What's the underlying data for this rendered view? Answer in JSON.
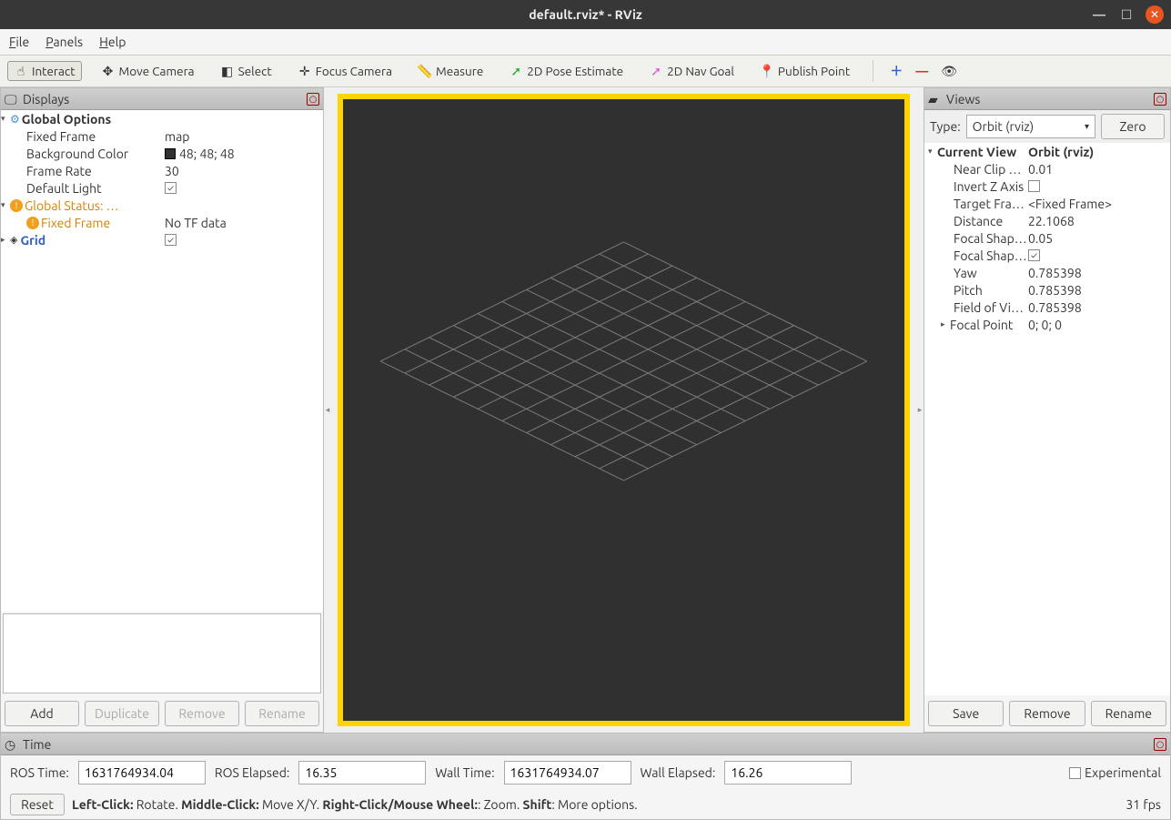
{
  "window": {
    "title": "default.rviz* - RViz"
  },
  "menu": {
    "file": "File",
    "panels": "Panels",
    "help": "Help"
  },
  "toolbar": {
    "interact": "Interact",
    "move_camera": "Move Camera",
    "select": "Select",
    "focus_camera": "Focus Camera",
    "measure": "Measure",
    "pose_estimate": "2D Pose Estimate",
    "nav_goal": "2D Nav Goal",
    "publish_point": "Publish Point"
  },
  "displays": {
    "title": "Displays",
    "global_options": "Global Options",
    "fixed_frame_label": "Fixed Frame",
    "fixed_frame_value": "map",
    "bg_label": "Background Color",
    "bg_value": "48; 48; 48",
    "frame_rate_label": "Frame Rate",
    "frame_rate_value": "30",
    "default_light_label": "Default Light",
    "global_status": "Global Status: …",
    "status_fixed_frame": "Fixed Frame",
    "status_value": "No TF data",
    "grid": "Grid",
    "buttons": {
      "add": "Add",
      "duplicate": "Duplicate",
      "remove": "Remove",
      "rename": "Rename"
    }
  },
  "views": {
    "title": "Views",
    "type_label": "Type:",
    "type_value": "Orbit (rviz)",
    "zero": "Zero",
    "current_view": "Current View",
    "current_value": "Orbit (rviz)",
    "props": {
      "near_clip_label": "Near Clip …",
      "near_clip_value": "0.01",
      "invert_z_label": "Invert Z Axis",
      "target_frame_label": "Target Fra…",
      "target_frame_value": "<Fixed Frame>",
      "distance_label": "Distance",
      "distance_value": "22.1068",
      "focal_size_label": "Focal Shap…",
      "focal_size_value": "0.05",
      "focal_fixed_label": "Focal Shap…",
      "yaw_label": "Yaw",
      "yaw_value": "0.785398",
      "pitch_label": "Pitch",
      "pitch_value": "0.785398",
      "fov_label": "Field of Vi…",
      "fov_value": "0.785398",
      "focal_point_label": "Focal Point",
      "focal_point_value": "0; 0; 0"
    },
    "buttons": {
      "save": "Save",
      "remove": "Remove",
      "rename": "Rename"
    }
  },
  "time": {
    "title": "Time",
    "ros_time_label": "ROS Time:",
    "ros_time_value": "1631764934.04",
    "ros_elapsed_label": "ROS Elapsed:",
    "ros_elapsed_value": "16.35",
    "wall_time_label": "Wall Time:",
    "wall_time_value": "1631764934.07",
    "wall_elapsed_label": "Wall Elapsed:",
    "wall_elapsed_value": "16.26",
    "experimental": "Experimental"
  },
  "status": {
    "reset": "Reset",
    "help_rotate_b": "Left-Click:",
    "help_rotate": " Rotate. ",
    "help_move_b": "Middle-Click:",
    "help_move": " Move X/Y. ",
    "help_zoom_b": "Right-Click/Mouse Wheel:",
    "help_zoom": ": Zoom. ",
    "help_shift_b": "Shift",
    "help_shift": ": More options.",
    "fps": "31 fps"
  }
}
